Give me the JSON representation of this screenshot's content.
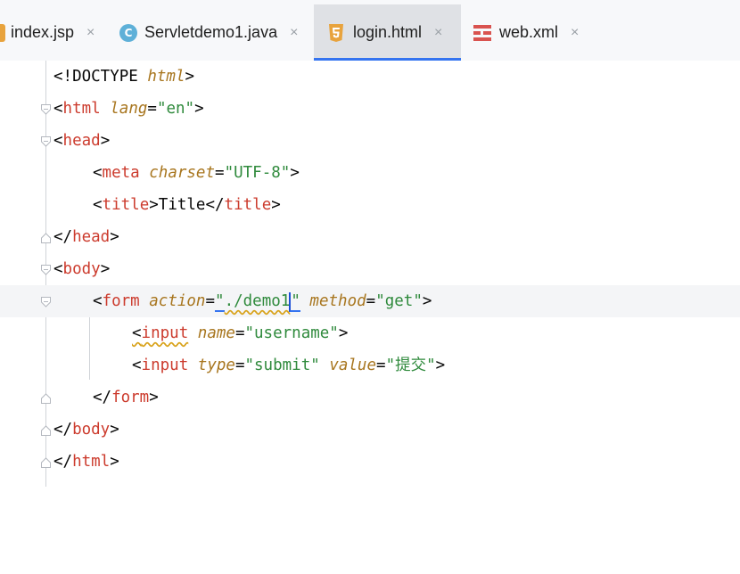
{
  "tabs": [
    {
      "label": "index.jsp",
      "icon": "jsp-file-icon",
      "active": false
    },
    {
      "label": "Servletdemo1.java",
      "icon": "java-class-icon",
      "icon_text": "C",
      "active": false
    },
    {
      "label": "login.html",
      "icon": "html5-file-icon",
      "active": true
    },
    {
      "label": "web.xml",
      "icon": "xml-file-icon",
      "active": false
    }
  ],
  "close_glyph": "×",
  "code": {
    "l1": {
      "open": "<!DOCTYPE ",
      "kw": "html",
      "close": ">"
    },
    "l2": {
      "lt": "<",
      "tag": "html",
      "attr": "lang",
      "eq": "=",
      "val": "\"en\"",
      "gt": ">"
    },
    "l3": {
      "lt": "<",
      "tag": "head",
      "gt": ">"
    },
    "l4": {
      "lt": "<",
      "tag": "meta",
      "attr": "charset",
      "eq": "=",
      "val": "\"UTF-8\"",
      "gt": ">"
    },
    "l5": {
      "lt": "<",
      "tag": "title",
      "gt": ">",
      "text": "Title",
      "lt2": "</",
      "tag2": "title",
      "gt2": ">"
    },
    "l6": {
      "lt": "</",
      "tag": "head",
      "gt": ">"
    },
    "l7": {
      "lt": "<",
      "tag": "body",
      "gt": ">"
    },
    "l8": {
      "lt": "<",
      "tag": "form",
      "attr": "action",
      "eq": "=",
      "q1": "\"",
      "val": "./demo1",
      "q2": "\"",
      "attr2": "method",
      "eq2": "=",
      "val2": "\"get\"",
      "gt": ">"
    },
    "l9": {
      "lt": "<",
      "tag": "input",
      "attr": "name",
      "eq": "=",
      "val": "\"username\"",
      "gt": ">"
    },
    "l10": {
      "lt": "<",
      "tag": "input",
      "attr": "type",
      "eq": "=",
      "val": "\"submit\"",
      "attr2": "value",
      "eq2": "=",
      "val2": "\"提交\"",
      "gt": ">"
    },
    "l11": {
      "lt": "</",
      "tag": "form",
      "gt": ">"
    },
    "l12": {
      "lt": "</",
      "tag": "body",
      "gt": ">"
    },
    "l13": {
      "lt": "</",
      "tag": "html",
      "gt": ">"
    }
  },
  "colors": {
    "tag": "#cc3b2d",
    "attr": "#a8761f",
    "string": "#2f8a3c",
    "accent": "#3574f0"
  }
}
